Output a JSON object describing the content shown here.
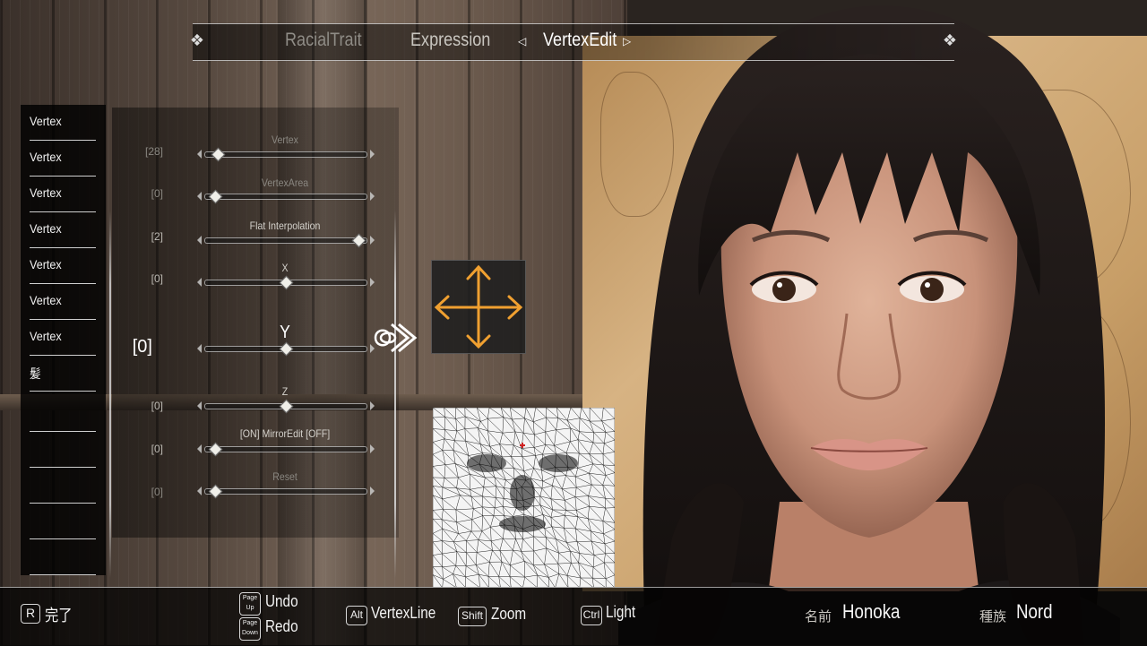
{
  "tabs": [
    {
      "label": "RacialTrait",
      "state": "dim"
    },
    {
      "label": "Expression",
      "state": "normal"
    },
    {
      "label": "VertexEdit",
      "state": "active"
    }
  ],
  "category_list": [
    "Vertex",
    "Vertex",
    "Vertex",
    "Vertex",
    "Vertex",
    "Vertex",
    "Vertex",
    "髪",
    "",
    "",
    "",
    "",
    ""
  ],
  "sliders": [
    {
      "value": "[28]",
      "label": "Vertex",
      "level": 0.08,
      "dim": true
    },
    {
      "value": "[0]",
      "label": "VertexArea",
      "level": 0.06,
      "dim": true
    },
    {
      "value": "[2]",
      "label": "Flat Interpolation",
      "level": 0.95,
      "dim": false
    },
    {
      "value": "[0]",
      "label": "X",
      "level": 0.5,
      "dim": false
    },
    {
      "value": "[0]",
      "label": "Y",
      "level": 0.5,
      "dim": false,
      "selected": true
    },
    {
      "value": "[0]",
      "label": "Z",
      "level": 0.5,
      "dim": false
    },
    {
      "value": "[0]",
      "label": "[ON] MirrorEdit [OFF]",
      "level": 0.06,
      "dim": false
    },
    {
      "value": "[0]",
      "label": "Reset",
      "level": 0.06,
      "dim": true
    }
  ],
  "bottom": {
    "done_key": "R",
    "done_label": "完了",
    "undo_key_top": "Page",
    "undo_key_bottom": "Up",
    "undo_label": "Undo",
    "redo_key_top": "Page",
    "redo_key_bottom": "Down",
    "redo_label": "Redo",
    "vertexline_key": "Alt",
    "vertexline_label": "VertexLine",
    "zoom_key": "Shift",
    "zoom_label": "Zoom",
    "light_key": "Ctrl",
    "light_label": "Light",
    "name_label": "名前",
    "name_value": "Honoka",
    "race_label": "種族",
    "race_value": "Nord"
  },
  "colors": {
    "move_arrows": "#f0a030",
    "mesh_marker": "#d02020"
  },
  "icons": {
    "move_pad": "four-way-move-arrows-icon",
    "selection_marker": "selector-ornament-icon"
  }
}
